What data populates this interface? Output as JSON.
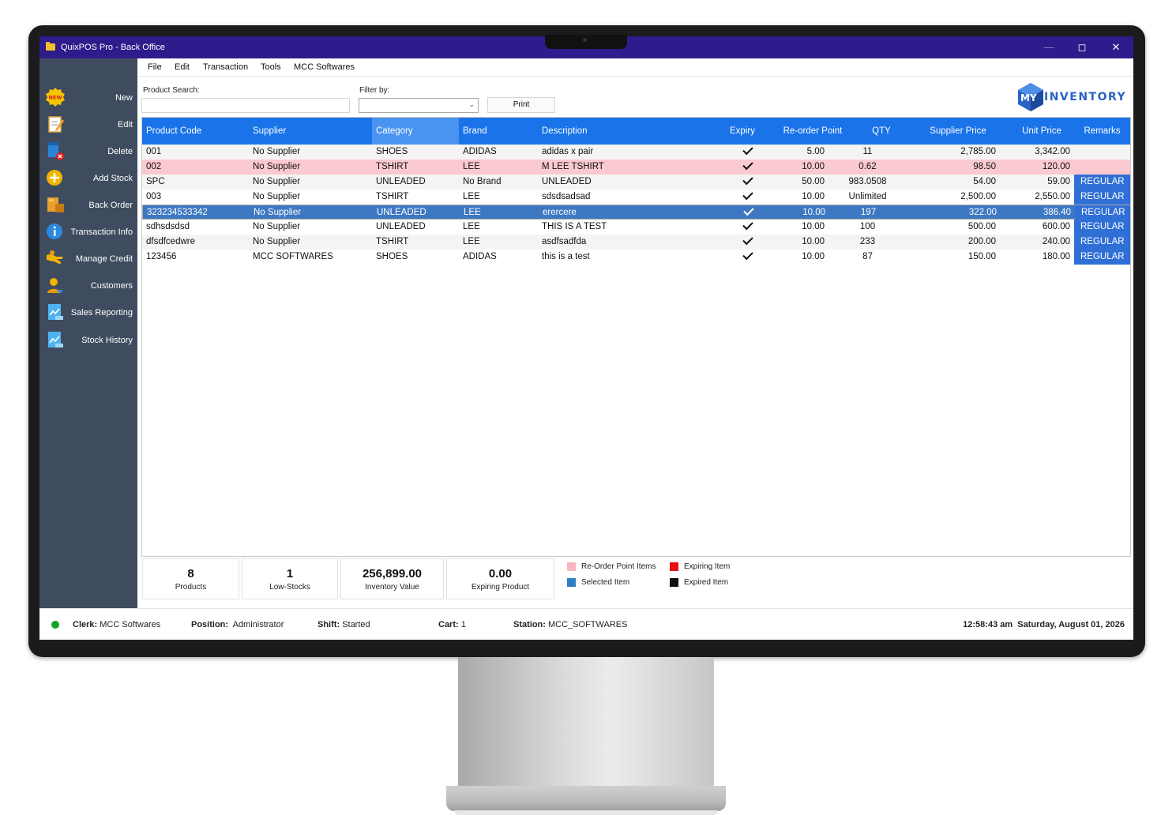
{
  "window": {
    "title": "QuixPOS Pro - Back Office",
    "controls": {
      "minimize": "—",
      "maximize": "◻",
      "close": "✕"
    }
  },
  "menu": [
    "File",
    "Edit",
    "Transaction",
    "Tools",
    "MCC Softwares"
  ],
  "sidebar": [
    {
      "label": "New",
      "icon": "new-badge-icon"
    },
    {
      "label": "Edit",
      "icon": "notepad-icon"
    },
    {
      "label": "Delete",
      "icon": "delete-icon"
    },
    {
      "label": "Add Stock",
      "icon": "plus-circle-icon"
    },
    {
      "label": "Back Order",
      "icon": "box-icon"
    },
    {
      "label": "Transaction Info",
      "icon": "info-icon"
    },
    {
      "label": "Manage Credit",
      "icon": "hand-icon"
    },
    {
      "label": "Customers",
      "icon": "user-icon"
    },
    {
      "label": "Sales Reporting",
      "icon": "chart-doc-icon"
    },
    {
      "label": "Stock History",
      "icon": "chart-doc-icon"
    }
  ],
  "search": {
    "label": "Product Search:",
    "value": ""
  },
  "filter": {
    "label": "Filter by:",
    "value": ""
  },
  "print_label": "Print",
  "logo": {
    "my": "MY",
    "word": "INVENTORY"
  },
  "table": {
    "headers": [
      "Product Code",
      "Supplier",
      "Category",
      "Brand",
      "Description",
      "Expiry",
      "Re-order Point",
      "QTY",
      "Supplier Price",
      "Unit Price",
      "Remarks"
    ],
    "rows": [
      {
        "code": "001",
        "supplier": "No Supplier",
        "category": "SHOES",
        "brand": "ADIDAS",
        "description": "adidas x pair",
        "expiry": true,
        "reorder": "5.00",
        "qty": "11",
        "supplier_price": "2,785.00",
        "unit_price": "3,342.00",
        "remarks": ""
      },
      {
        "code": "002",
        "supplier": "No Supplier",
        "category": "TSHIRT",
        "brand": "LEE",
        "description": "M LEE TSHIRT",
        "expiry": true,
        "reorder": "10.00",
        "qty": "0.62",
        "supplier_price": "98.50",
        "unit_price": "120.00",
        "remarks": ""
      },
      {
        "code": "SPC",
        "supplier": "No Supplier",
        "category": "UNLEADED",
        "brand": "No Brand",
        "description": "UNLEADED",
        "expiry": true,
        "reorder": "50.00",
        "qty": "983.0508",
        "supplier_price": "54.00",
        "unit_price": "59.00",
        "remarks": "REGULAR"
      },
      {
        "code": "003",
        "supplier": "No Supplier",
        "category": "TSHIRT",
        "brand": "LEE",
        "description": "sdsdsadsad",
        "expiry": true,
        "reorder": "10.00",
        "qty": "Unlimited",
        "supplier_price": "2,500.00",
        "unit_price": "2,550.00",
        "remarks": "REGULAR"
      },
      {
        "code": "323234533342",
        "supplier": "No Supplier",
        "category": "UNLEADED",
        "brand": "LEE",
        "description": "erercere",
        "expiry": true,
        "reorder": "10.00",
        "qty": "197",
        "supplier_price": "322.00",
        "unit_price": "386.40",
        "remarks": "REGULAR"
      },
      {
        "code": "sdhsdsdsd",
        "supplier": "No Supplier",
        "category": "UNLEADED",
        "brand": "LEE",
        "description": "THIS IS A TEST",
        "expiry": true,
        "reorder": "10.00",
        "qty": "100",
        "supplier_price": "500.00",
        "unit_price": "600.00",
        "remarks": "REGULAR"
      },
      {
        "code": "dfsdfcedwre",
        "supplier": "No Supplier",
        "category": "TSHIRT",
        "brand": "LEE",
        "description": "asdfsadfda",
        "expiry": true,
        "reorder": "10.00",
        "qty": "233",
        "supplier_price": "200.00",
        "unit_price": "240.00",
        "remarks": "REGULAR"
      },
      {
        "code": "123456",
        "supplier": "MCC SOFTWARES",
        "category": "SHOES",
        "brand": "ADIDAS",
        "description": "this is a test",
        "expiry": true,
        "reorder": "10.00",
        "qty": "87",
        "supplier_price": "150.00",
        "unit_price": "180.00",
        "remarks": "REGULAR"
      }
    ],
    "reorder_row_index": 1,
    "selected_row_index": 4
  },
  "stats": [
    {
      "value": "8",
      "label": "Products"
    },
    {
      "value": "1",
      "label": "Low-Stocks"
    },
    {
      "value": "256,899.00",
      "label": "Inventory Value"
    },
    {
      "value": "0.00",
      "label": "Expiring Product"
    }
  ],
  "legend": [
    {
      "label": "Re-Order Point Items",
      "color": "#f7b6c0"
    },
    {
      "label": "Expiring Item",
      "color": "#e81010"
    },
    {
      "label": "Selected Item",
      "color": "#2f7fc4"
    },
    {
      "label": "Expired Item",
      "color": "#111111"
    }
  ],
  "status": {
    "clerk_label": "Clerk:",
    "clerk": "MCC Softwares",
    "position_label": "Position:",
    "position": "Administrator",
    "shift_label": "Shift:",
    "shift": "Started",
    "cart_label": "Cart:",
    "cart": "1",
    "station_label": "Station:",
    "station": "MCC_SOFTWARES",
    "time": "12:58:43 am",
    "date": "Saturday, August 01, 2026",
    "online_color": "#12a32a"
  },
  "colors": {
    "titlebar": "#2e1b8c",
    "sidebar": "#3f4c5f",
    "header": "#1a73e8",
    "remark": "#2f6fd6",
    "selected": "#3f78c2",
    "reorder": "#fbc9d0"
  }
}
